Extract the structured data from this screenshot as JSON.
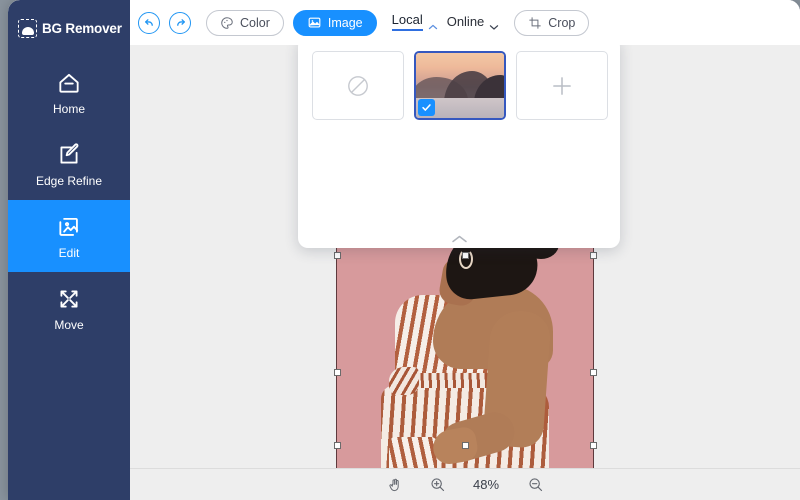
{
  "app": {
    "name": "BG Remover",
    "logo_icon": "image-cloud-icon"
  },
  "sidebar": {
    "items": [
      {
        "label": "Home",
        "icon": "home-icon",
        "active": false
      },
      {
        "label": "Edge Refine",
        "icon": "edge-refine-icon",
        "active": false
      },
      {
        "label": "Edit",
        "icon": "edit-image-icon",
        "active": true
      },
      {
        "label": "Move",
        "icon": "move-arrows-icon",
        "active": false
      }
    ],
    "active_color": "#1890ff",
    "background_color": "#2e3e68"
  },
  "toolbar": {
    "undo_label": "Undo",
    "undo_icon": "undo-arrow-icon",
    "redo_label": "Redo",
    "redo_icon": "redo-arrow-icon",
    "color_label": "Color",
    "color_icon": "palette-icon",
    "image_label": "Image",
    "image_icon": "picture-icon",
    "crop_label": "Crop",
    "crop_icon": "crop-icon",
    "tabs": [
      {
        "label": "Local",
        "active": true,
        "chevron": "chevron-up-icon"
      },
      {
        "label": "Online",
        "active": false,
        "chevron": "chevron-down-icon"
      }
    ],
    "accent_color": "#1890ff",
    "tab_underline_color": "#2f6fe0"
  },
  "panel": {
    "collapse_icon": "chevron-up-icon",
    "tiles": [
      {
        "type": "none",
        "icon": "no-background-icon",
        "selected": false,
        "label": "No background"
      },
      {
        "type": "thumbnail",
        "icon": "sunset-lake-thumbnail",
        "selected": true,
        "label": "Sunset lake background",
        "check_icon": "check-icon"
      },
      {
        "type": "add",
        "icon": "plus-icon",
        "selected": false,
        "label": "Add image"
      }
    ]
  },
  "canvas": {
    "background_color": "#eeeeee",
    "artboard_color": "#d79a9c",
    "subject_alt": "Woman in striped dress on pink background",
    "selection_handles": 8
  },
  "statusbar": {
    "hand_tool_icon": "hand-icon",
    "zoom_in_icon": "zoom-in-icon",
    "zoom_out_icon": "zoom-out-icon",
    "zoom_level": "48%"
  }
}
